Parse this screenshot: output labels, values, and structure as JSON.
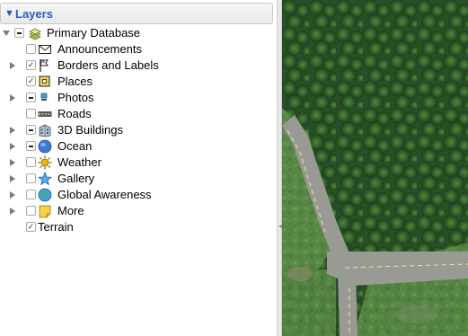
{
  "layers_panel": {
    "title": "Layers",
    "items": [
      {
        "label": "Primary Database",
        "icon": "database-stack-icon"
      },
      {
        "label": "Announcements",
        "icon": "envelope-icon"
      },
      {
        "label": "Borders and Labels",
        "icon": "flag-icon"
      },
      {
        "label": "Places",
        "icon": "place-square-icon"
      },
      {
        "label": "Photos",
        "icon": "photo-icon"
      },
      {
        "label": "Roads",
        "icon": "road-icon"
      },
      {
        "label": "3D Buildings",
        "icon": "building-icon"
      },
      {
        "label": "Ocean",
        "icon": "globe-icon"
      },
      {
        "label": "Weather",
        "icon": "sun-icon"
      },
      {
        "label": "Gallery",
        "icon": "star-icon"
      },
      {
        "label": "Global Awareness",
        "icon": "globe-icon"
      },
      {
        "label": "More",
        "icon": "note-icon"
      },
      {
        "label": "Terrain",
        "icon": ""
      }
    ]
  },
  "colors": {
    "accent": "#1f5fbf",
    "map_green": "#2f5a2a",
    "road_gray": "#9a9a94"
  }
}
